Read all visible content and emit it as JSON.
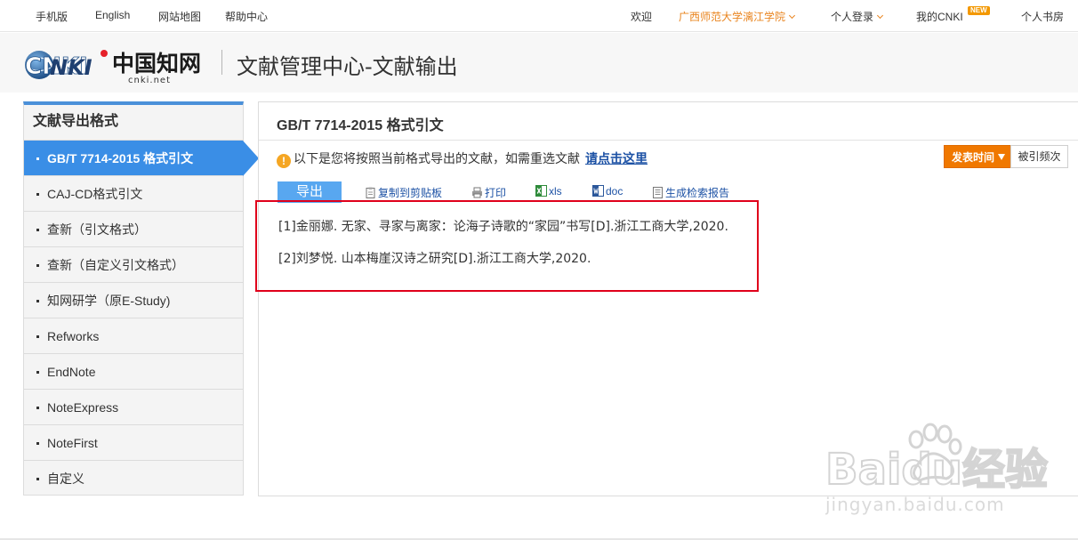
{
  "topbar": {
    "left_links": [
      "手机版",
      "English",
      "网站地图",
      "帮助中心"
    ],
    "welcome": "欢迎",
    "institution": "广西师范大学漓江学院",
    "login": "个人登录",
    "my_cnki": "我的CNKI",
    "new_badge": "NEW",
    "bookroom": "个人书房"
  },
  "header": {
    "logo_text": "CNKI",
    "logo_chinese": "中国知网",
    "logo_domain": "cnki.net",
    "title": "文献管理中心-文献输出"
  },
  "sidebar": {
    "title": "文献导出格式",
    "items": [
      {
        "label": "GB/T 7714-2015 格式引文",
        "active": true
      },
      {
        "label": "CAJ-CD格式引文",
        "active": false
      },
      {
        "label": "查新（引文格式）",
        "active": false
      },
      {
        "label": "查新（自定义引文格式）",
        "active": false
      },
      {
        "label": "知网研学（原E-Study)",
        "active": false
      },
      {
        "label": "Refworks",
        "active": false
      },
      {
        "label": "EndNote",
        "active": false
      },
      {
        "label": "NoteExpress",
        "active": false
      },
      {
        "label": "NoteFirst",
        "active": false
      },
      {
        "label": "自定义",
        "active": false
      }
    ]
  },
  "main": {
    "title": "GB/T 7714-2015 格式引文",
    "notice": "以下是您将按照当前格式导出的文献，如需重选文献",
    "notice_link": "请点击这里",
    "sort_pubtime": "发表时间",
    "sort_cited": "被引频次",
    "toolbar": {
      "export": "导出",
      "copy": "复制到剪贴板",
      "print": "打印",
      "xls": "xls",
      "doc": "doc",
      "report": "生成检索报告"
    },
    "citations": [
      "[1]金丽娜. 无家、寻家与离家：论海子诗歌的“家园”书写[D].浙江工商大学,2020.",
      "[2]刘梦悦. 山本梅崖汉诗之研究[D].浙江工商大学,2020."
    ]
  },
  "watermark": {
    "brand": "Baidu经验",
    "url": "jingyan.baidu.com"
  },
  "colors": {
    "accent_blue": "#3a8ee6",
    "orange": "#f07800",
    "link_blue": "#1d52a5",
    "highlight_red": "#e0001b"
  }
}
